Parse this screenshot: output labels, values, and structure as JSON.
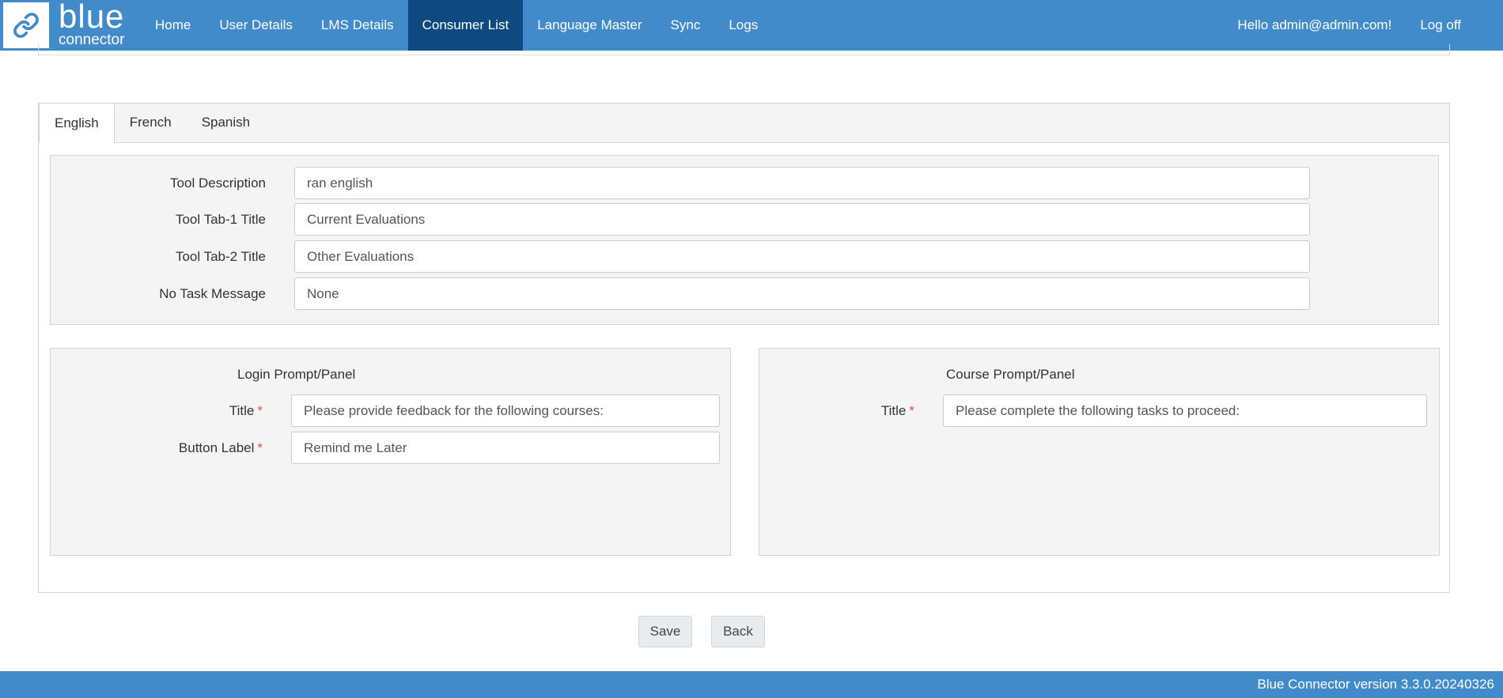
{
  "brand": {
    "name": "blue",
    "sub": "connector"
  },
  "nav": {
    "items": [
      {
        "label": "Home"
      },
      {
        "label": "User Details"
      },
      {
        "label": "LMS Details"
      },
      {
        "label": "Consumer List",
        "active": true
      },
      {
        "label": "Language Master"
      },
      {
        "label": "Sync"
      },
      {
        "label": "Logs"
      }
    ],
    "greeting": "Hello admin@admin.com!",
    "logoff": "Log off"
  },
  "tabs": [
    {
      "label": "English",
      "active": true
    },
    {
      "label": "French"
    },
    {
      "label": "Spanish"
    }
  ],
  "tool": {
    "description_label": "Tool Description",
    "description_value": "ran english",
    "tab1_label": "Tool Tab-1 Title",
    "tab1_value": "Current Evaluations",
    "tab2_label": "Tool Tab-2 Title",
    "tab2_value": "Other Evaluations",
    "notask_label": "No Task Message",
    "notask_value": "None"
  },
  "login_panel": {
    "heading": "Login Prompt/Panel",
    "title_label": "Title",
    "title_value": "Please provide feedback for the following courses:",
    "button_label": "Button Label",
    "button_value": "Remind me Later",
    "required_mark": "*"
  },
  "course_panel": {
    "heading": "Course Prompt/Panel",
    "title_label": "Title",
    "title_value": "Please complete the following tasks to proceed:",
    "required_mark": "*"
  },
  "actions": {
    "save": "Save",
    "back": "Back"
  },
  "footer": {
    "version": "Blue Connector version 3.3.0.20240326"
  },
  "colors": {
    "navbar": "#428bca",
    "nav_active": "#0e4a80",
    "required": "#d9534f",
    "panel_bg": "#f4f4f4"
  },
  "icons": {
    "logo": "link-chain-icon"
  }
}
